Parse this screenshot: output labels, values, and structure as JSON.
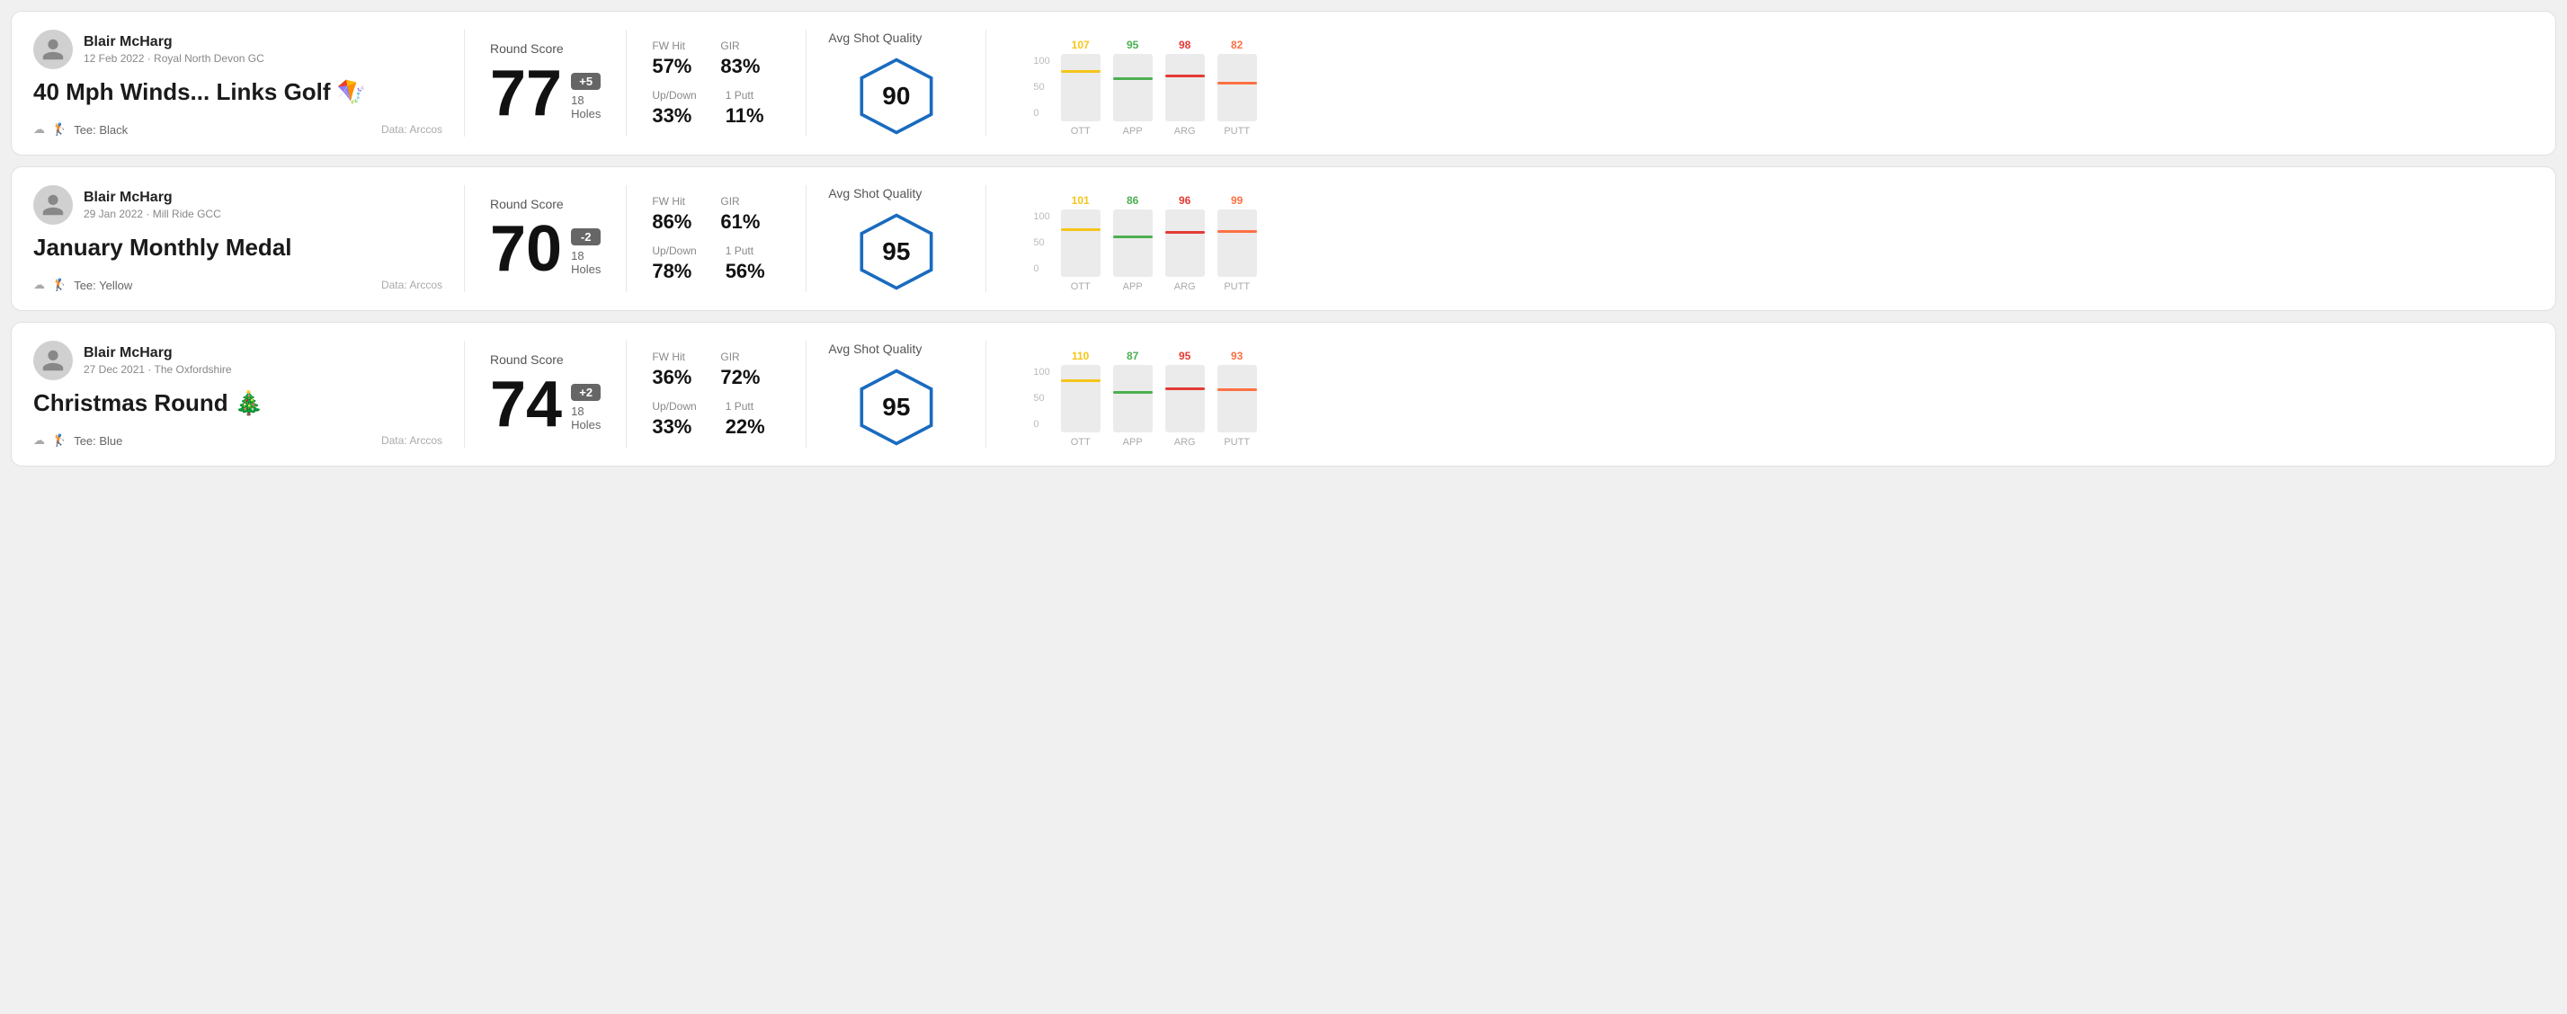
{
  "rounds": [
    {
      "id": "round-1",
      "player": {
        "name": "Blair McHarg",
        "meta": "12 Feb 2022 · Royal North Devon GC"
      },
      "title": "40 Mph Winds... Links Golf 🪁",
      "tee": "Black",
      "data_source": "Data: Arccos",
      "score": {
        "label": "Round Score",
        "number": "77",
        "badge": "+5",
        "badge_type": "positive",
        "holes": "18 Holes"
      },
      "stats": {
        "fw_hit_label": "FW Hit",
        "fw_hit_value": "57%",
        "gir_label": "GIR",
        "gir_value": "83%",
        "updown_label": "Up/Down",
        "updown_value": "33%",
        "oneputt_label": "1 Putt",
        "oneputt_value": "11%"
      },
      "quality": {
        "label": "Avg Shot Quality",
        "score": "90"
      },
      "chart": {
        "bars": [
          {
            "label": "OTT",
            "value": 107,
            "color": "#f5c518",
            "height_pct": 72
          },
          {
            "label": "APP",
            "value": 95,
            "color": "#4caf50",
            "height_pct": 62
          },
          {
            "label": "ARG",
            "value": 98,
            "color": "#e53935",
            "height_pct": 65
          },
          {
            "label": "PUTT",
            "value": 82,
            "color": "#ff7043",
            "height_pct": 55
          }
        ],
        "y_labels": [
          "100",
          "50",
          "0"
        ]
      }
    },
    {
      "id": "round-2",
      "player": {
        "name": "Blair McHarg",
        "meta": "29 Jan 2022 · Mill Ride GCC"
      },
      "title": "January Monthly Medal",
      "tee": "Yellow",
      "data_source": "Data: Arccos",
      "score": {
        "label": "Round Score",
        "number": "70",
        "badge": "-2",
        "badge_type": "negative",
        "holes": "18 Holes"
      },
      "stats": {
        "fw_hit_label": "FW Hit",
        "fw_hit_value": "86%",
        "gir_label": "GIR",
        "gir_value": "61%",
        "updown_label": "Up/Down",
        "updown_value": "78%",
        "oneputt_label": "1 Putt",
        "oneputt_value": "56%"
      },
      "quality": {
        "label": "Avg Shot Quality",
        "score": "95"
      },
      "chart": {
        "bars": [
          {
            "label": "OTT",
            "value": 101,
            "color": "#f5c518",
            "height_pct": 68
          },
          {
            "label": "APP",
            "value": 86,
            "color": "#4caf50",
            "height_pct": 57
          },
          {
            "label": "ARG",
            "value": 96,
            "color": "#e53935",
            "height_pct": 64
          },
          {
            "label": "PUTT",
            "value": 99,
            "color": "#ff7043",
            "height_pct": 66
          }
        ],
        "y_labels": [
          "100",
          "50",
          "0"
        ]
      }
    },
    {
      "id": "round-3",
      "player": {
        "name": "Blair McHarg",
        "meta": "27 Dec 2021 · The Oxfordshire"
      },
      "title": "Christmas Round 🎄",
      "tee": "Blue",
      "data_source": "Data: Arccos",
      "score": {
        "label": "Round Score",
        "number": "74",
        "badge": "+2",
        "badge_type": "positive",
        "holes": "18 Holes"
      },
      "stats": {
        "fw_hit_label": "FW Hit",
        "fw_hit_value": "36%",
        "gir_label": "GIR",
        "gir_value": "72%",
        "updown_label": "Up/Down",
        "updown_value": "33%",
        "oneputt_label": "1 Putt",
        "oneputt_value": "22%"
      },
      "quality": {
        "label": "Avg Shot Quality",
        "score": "95"
      },
      "chart": {
        "bars": [
          {
            "label": "OTT",
            "value": 110,
            "color": "#f5c518",
            "height_pct": 75
          },
          {
            "label": "APP",
            "value": 87,
            "color": "#4caf50",
            "height_pct": 58
          },
          {
            "label": "ARG",
            "value": 95,
            "color": "#e53935",
            "height_pct": 63
          },
          {
            "label": "PUTT",
            "value": 93,
            "color": "#ff7043",
            "height_pct": 62
          }
        ],
        "y_labels": [
          "100",
          "50",
          "0"
        ]
      }
    }
  ]
}
